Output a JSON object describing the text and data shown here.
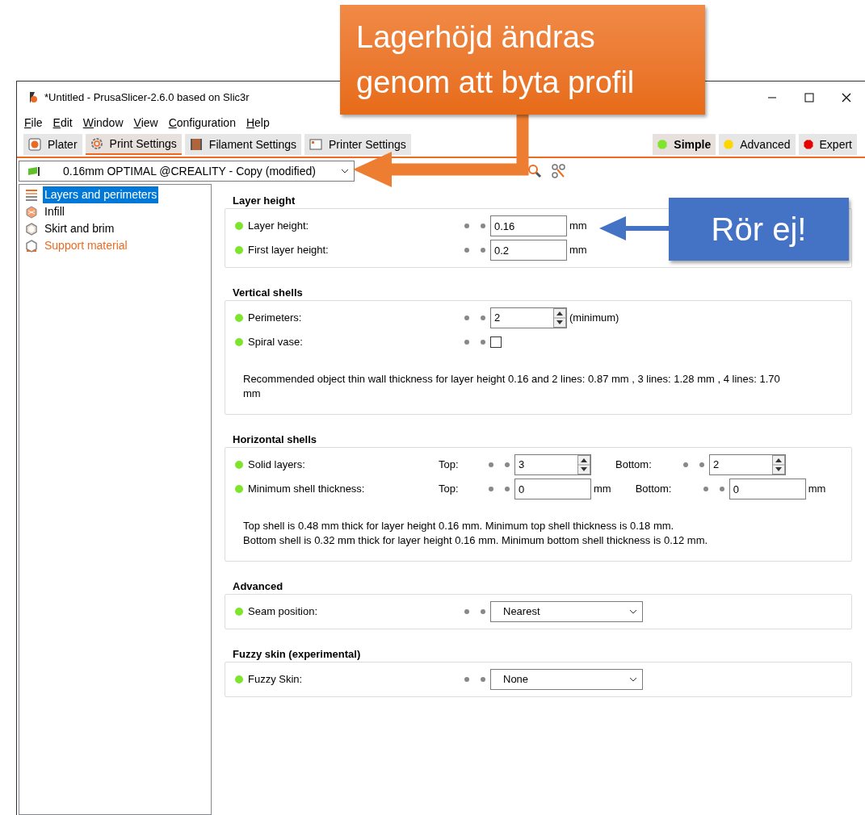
{
  "callouts": [
    {
      "kind": "orange",
      "text": "Lagerhöjd ändras genom att byta profil"
    },
    {
      "kind": "blue",
      "text": "Rör ej!"
    }
  ],
  "window": {
    "title": "*Untitled - PrusaSlicer-2.6.0 based on Slic3r"
  },
  "menu": [
    "File",
    "Edit",
    "Window",
    "View",
    "Configuration",
    "Help"
  ],
  "tabs": [
    {
      "kind": "plater",
      "label": "Plater",
      "selected": false
    },
    {
      "kind": "print",
      "label": "Print Settings",
      "selected": true
    },
    {
      "kind": "filament",
      "label": "Filament Settings",
      "selected": false
    },
    {
      "kind": "printer",
      "label": "Printer Settings",
      "selected": false
    }
  ],
  "modes": [
    {
      "label": "Simple",
      "selected": true,
      "color": "#7ee52c"
    },
    {
      "label": "Advanced",
      "selected": false,
      "color": "#ffd700"
    },
    {
      "label": "Expert",
      "selected": false,
      "color": "#e60000"
    }
  ],
  "preset": "0.16mm OPTIMAL @CREALITY - Copy (modified)",
  "pages": [
    {
      "kind": "layers",
      "label": "Layers and perimeters",
      "selected": true,
      "modified": false
    },
    {
      "kind": "infill",
      "label": "Infill",
      "selected": false,
      "modified": false
    },
    {
      "kind": "skirt",
      "label": "Skirt and brim",
      "selected": false,
      "modified": false
    },
    {
      "kind": "support",
      "label": "Support material",
      "selected": false,
      "modified": true
    }
  ],
  "sections": [
    {
      "title": "Layer height",
      "rows": [
        {
          "kind": "text",
          "label": "Layer height:",
          "value": "0.16",
          "unit": "mm"
        },
        {
          "kind": "text",
          "label": "First layer height:",
          "value": "0.2",
          "unit": "mm"
        }
      ]
    },
    {
      "title": "Vertical shells",
      "rows": [
        {
          "kind": "spin",
          "label": "Perimeters:",
          "value": "2",
          "unit": "(minimum)"
        },
        {
          "kind": "checkbox",
          "label": "Spiral vase:",
          "checked": false
        }
      ],
      "note": "Recommended object thin wall thickness for layer height 0.16 and 2 lines: 0.87 mm , 3 lines: 1.28 mm , 4 lines: 1.70 mm"
    },
    {
      "title": "Horizontal shells",
      "rows": [
        {
          "kind": "pair",
          "label": "Solid layers:",
          "fields": [
            {
              "kind": "spin",
              "label": "Top:",
              "value": "3"
            },
            {
              "kind": "spin",
              "label": "Bottom:",
              "value": "2"
            }
          ]
        },
        {
          "kind": "pair",
          "label": "Minimum shell thickness:",
          "fields": [
            {
              "kind": "text",
              "label": "Top:",
              "value": "0",
              "unit": "mm"
            },
            {
              "kind": "text",
              "label": "Bottom:",
              "value": "0",
              "unit": "mm"
            }
          ]
        }
      ],
      "note": "Top shell is 0.48 mm thick for layer height 0.16 mm. Minimum top shell thickness is 0.18 mm.\nBottom shell is 0.32 mm thick for layer height 0.16 mm. Minimum bottom shell thickness is 0.12 mm."
    },
    {
      "title": "Advanced",
      "rows": [
        {
          "kind": "select",
          "label": "Seam position:",
          "value": "Nearest"
        }
      ]
    },
    {
      "title": "Fuzzy skin (experimental)",
      "rows": [
        {
          "kind": "select",
          "label": "Fuzzy Skin:",
          "value": "None"
        }
      ]
    }
  ]
}
